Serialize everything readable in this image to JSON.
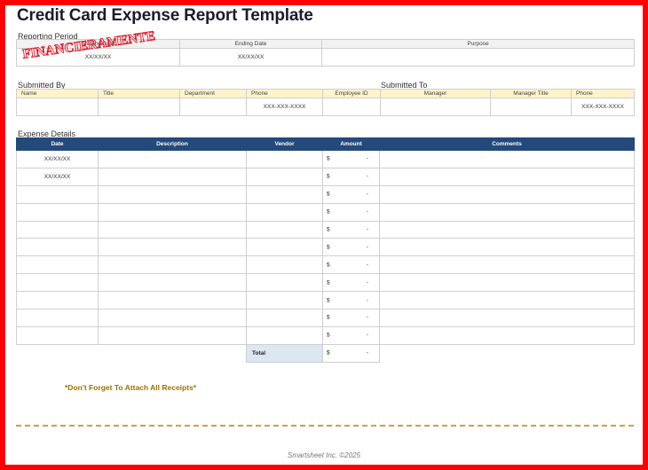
{
  "title": "Credit Card Expense Report Template",
  "watermark": "FINANCIERAMENTE",
  "reporting_period": {
    "label": "Reporting Period",
    "headers": [
      "Starting Date",
      "Ending Date",
      "Purpose"
    ],
    "values": [
      "XX/XX/XX",
      "XX/XX/XX",
      ""
    ]
  },
  "submitted_by": {
    "label": "Submitted By",
    "headers": [
      "Name",
      "Title",
      "Department",
      "Phone",
      "Employee ID"
    ],
    "values": [
      "",
      "",
      "",
      "XXX-XXX-XXXX",
      ""
    ]
  },
  "submitted_to": {
    "label": "Submitted To",
    "headers": [
      "Manager",
      "Manager Title",
      "Phone"
    ],
    "values": [
      "",
      "",
      "XXX-XXX-XXXX"
    ]
  },
  "expense_details": {
    "label": "Expense Details",
    "headers": [
      "Date",
      "Description",
      "Vendor",
      "Amount",
      "Comments"
    ],
    "rows": [
      [
        "XX/XX/XX",
        "",
        "",
        "",
        ""
      ],
      [
        "XX/XX/XX",
        "",
        "",
        "",
        ""
      ],
      [
        "",
        "",
        "",
        "",
        ""
      ],
      [
        "",
        "",
        "",
        "",
        ""
      ],
      [
        "",
        "",
        "",
        "",
        ""
      ],
      [
        "",
        "",
        "",
        "",
        ""
      ],
      [
        "",
        "",
        "",
        "",
        ""
      ],
      [
        "",
        "",
        "",
        "",
        ""
      ],
      [
        "",
        "",
        "",
        "",
        ""
      ],
      [
        "",
        "",
        "",
        "",
        ""
      ],
      [
        "",
        "",
        "",
        "",
        ""
      ]
    ],
    "currency_symbol": "$",
    "amount_placeholder": "-",
    "total_label": "Total",
    "total_placeholder": "-"
  },
  "note": "*Don't Forget To Attach All Receipts*",
  "footer": "Smartsheet Inc. ©2025",
  "colors": {
    "frame": "#ff0000",
    "header_blue": "#24497a",
    "header_yellow": "#fff3cc",
    "header_grey": "#f2f2f2",
    "total_fill": "#dbe7f3",
    "note_text": "#9a7300",
    "divider": "#d79d3a",
    "watermark": "#e41b2b"
  }
}
